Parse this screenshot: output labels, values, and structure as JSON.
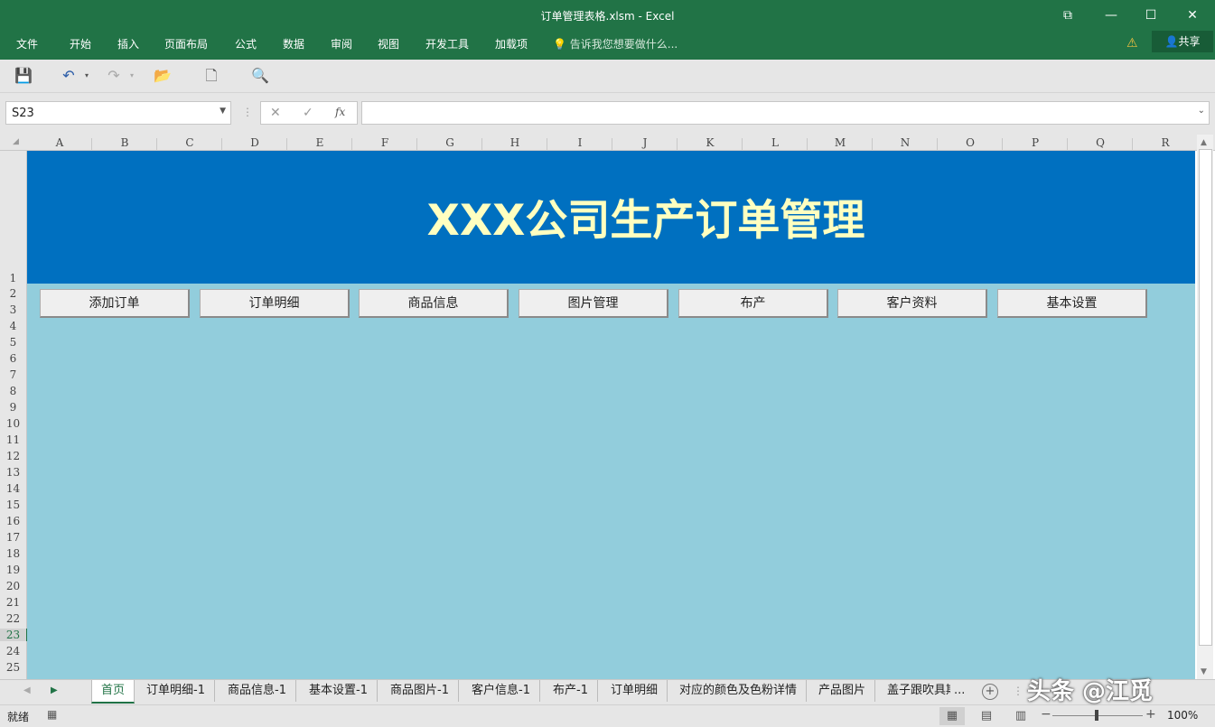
{
  "window": {
    "title": "订单管理表格.xlsm - Excel",
    "ribbon_tabs": [
      "文件",
      "开始",
      "插入",
      "页面布局",
      "公式",
      "数据",
      "审阅",
      "视图",
      "开发工具",
      "加载项"
    ],
    "tell_me": "告诉我您想要做什么...",
    "share": "共享"
  },
  "formula_bar": {
    "name_box": "S23",
    "fx": "fx",
    "formula": ""
  },
  "grid": {
    "columns": [
      "A",
      "B",
      "C",
      "D",
      "E",
      "F",
      "G",
      "H",
      "I",
      "J",
      "K",
      "L",
      "M",
      "N",
      "O",
      "P",
      "Q",
      "R"
    ],
    "rows": [
      "1",
      "2",
      "3",
      "4",
      "5",
      "6",
      "7",
      "8",
      "9",
      "10",
      "11",
      "12",
      "13",
      "14",
      "15",
      "16",
      "17",
      "18",
      "19",
      "20",
      "21",
      "22",
      "23",
      "24",
      "25"
    ]
  },
  "sheet": {
    "banner_title": "XXX公司生产订单管理",
    "buttons": [
      "添加订单",
      "订单明细",
      "商品信息",
      "图片管理",
      "布产",
      "客户资料",
      "基本设置"
    ],
    "colors": {
      "banner": "#0070c0",
      "background": "#92cddc",
      "title_text": "#ffffc0"
    }
  },
  "sheet_tabs": [
    "首页",
    "订单明细-1",
    "商品信息-1",
    "基本设置-1",
    "商品图片-1",
    "客户信息-1",
    "布产-1",
    "订单明细",
    "对应的颜色及色粉详情",
    "产品图片",
    "盖子跟吹具期"
  ],
  "active_tab": "首页",
  "more_tabs": "...",
  "status": {
    "ready": "就绪",
    "zoom": "100%"
  },
  "watermark": "头条 @江觅"
}
